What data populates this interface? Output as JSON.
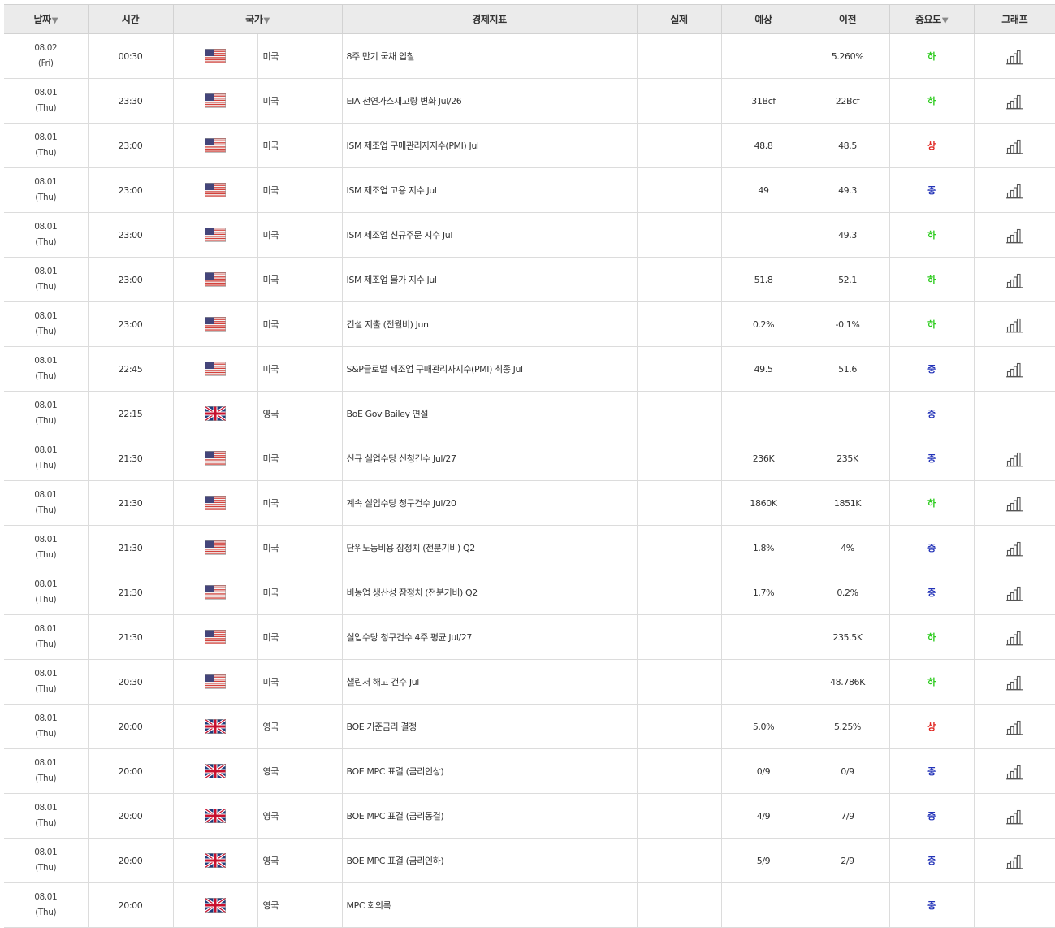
{
  "headers": {
    "date": "날짜",
    "time": "시간",
    "country": "국가",
    "indicator": "경제지표",
    "actual": "실제",
    "forecast": "예상",
    "previous": "이전",
    "importance": "중요도",
    "graph": "그래프",
    "sort_arrow": "▼"
  },
  "colors": {
    "importance_low": "#2ecc1f",
    "importance_mid": "#2333b8",
    "importance_high": "#e0241f",
    "header_bg": "#ebebeb"
  },
  "rows": [
    {
      "date": "08.02",
      "day": "(Fri)",
      "time": "00:30",
      "flag": "us",
      "country": "미국",
      "indicator": "8주 만기 국채 입찰",
      "actual": "",
      "forecast": "",
      "previous": "5.260%",
      "importance": "하",
      "level": "low",
      "graph": true
    },
    {
      "date": "08.01",
      "day": "(Thu)",
      "time": "23:30",
      "flag": "us",
      "country": "미국",
      "indicator": "EIA 천연가스재고량 변화 Jul/26",
      "actual": "",
      "forecast": "31Bcf",
      "previous": "22Bcf",
      "importance": "하",
      "level": "low",
      "graph": true
    },
    {
      "date": "08.01",
      "day": "(Thu)",
      "time": "23:00",
      "flag": "us",
      "country": "미국",
      "indicator": "ISM 제조업 구매관리자지수(PMI) Jul",
      "actual": "",
      "forecast": "48.8",
      "previous": "48.5",
      "importance": "상",
      "level": "high",
      "graph": true
    },
    {
      "date": "08.01",
      "day": "(Thu)",
      "time": "23:00",
      "flag": "us",
      "country": "미국",
      "indicator": "ISM 제조업 고용 지수 Jul",
      "actual": "",
      "forecast": "49",
      "previous": "49.3",
      "importance": "중",
      "level": "mid",
      "graph": true
    },
    {
      "date": "08.01",
      "day": "(Thu)",
      "time": "23:00",
      "flag": "us",
      "country": "미국",
      "indicator": "ISM 제조업 신규주문 지수 Jul",
      "actual": "",
      "forecast": "",
      "previous": "49.3",
      "importance": "하",
      "level": "low",
      "graph": true
    },
    {
      "date": "08.01",
      "day": "(Thu)",
      "time": "23:00",
      "flag": "us",
      "country": "미국",
      "indicator": "ISM 제조업 물가 지수 Jul",
      "actual": "",
      "forecast": "51.8",
      "previous": "52.1",
      "importance": "하",
      "level": "low",
      "graph": true
    },
    {
      "date": "08.01",
      "day": "(Thu)",
      "time": "23:00",
      "flag": "us",
      "country": "미국",
      "indicator": "건설 지출 (전월비) Jun",
      "actual": "",
      "forecast": "0.2%",
      "previous": "-0.1%",
      "importance": "하",
      "level": "low",
      "graph": true
    },
    {
      "date": "08.01",
      "day": "(Thu)",
      "time": "22:45",
      "flag": "us",
      "country": "미국",
      "indicator": "S&P글로벌 제조업 구매관리자지수(PMI) 최종 Jul",
      "actual": "",
      "forecast": "49.5",
      "previous": "51.6",
      "importance": "중",
      "level": "mid",
      "graph": true
    },
    {
      "date": "08.01",
      "day": "(Thu)",
      "time": "22:15",
      "flag": "uk",
      "country": "영국",
      "indicator": "BoE Gov Bailey 연설",
      "actual": "",
      "forecast": "",
      "previous": "",
      "importance": "중",
      "level": "mid",
      "graph": false
    },
    {
      "date": "08.01",
      "day": "(Thu)",
      "time": "21:30",
      "flag": "us",
      "country": "미국",
      "indicator": "신규 실업수당 신청건수 Jul/27",
      "actual": "",
      "forecast": "236K",
      "previous": "235K",
      "importance": "중",
      "level": "mid",
      "graph": true
    },
    {
      "date": "08.01",
      "day": "(Thu)",
      "time": "21:30",
      "flag": "us",
      "country": "미국",
      "indicator": "계속 실업수당 청구건수 Jul/20",
      "actual": "",
      "forecast": "1860K",
      "previous": "1851K",
      "importance": "하",
      "level": "low",
      "graph": true
    },
    {
      "date": "08.01",
      "day": "(Thu)",
      "time": "21:30",
      "flag": "us",
      "country": "미국",
      "indicator": "단위노동비용 잠정치 (전분기비) Q2",
      "actual": "",
      "forecast": "1.8%",
      "previous": "4%",
      "importance": "중",
      "level": "mid",
      "graph": true
    },
    {
      "date": "08.01",
      "day": "(Thu)",
      "time": "21:30",
      "flag": "us",
      "country": "미국",
      "indicator": "비농업 생산성 잠정치 (전분기비) Q2",
      "actual": "",
      "forecast": "1.7%",
      "previous": "0.2%",
      "importance": "중",
      "level": "mid",
      "graph": true
    },
    {
      "date": "08.01",
      "day": "(Thu)",
      "time": "21:30",
      "flag": "us",
      "country": "미국",
      "indicator": "실업수당 청구건수 4주 평균 Jul/27",
      "actual": "",
      "forecast": "",
      "previous": "235.5K",
      "importance": "하",
      "level": "low",
      "graph": true
    },
    {
      "date": "08.01",
      "day": "(Thu)",
      "time": "20:30",
      "flag": "us",
      "country": "미국",
      "indicator": "챌린저 해고 건수 Jul",
      "actual": "",
      "forecast": "",
      "previous": "48.786K",
      "importance": "하",
      "level": "low",
      "graph": true
    },
    {
      "date": "08.01",
      "day": "(Thu)",
      "time": "20:00",
      "flag": "uk",
      "country": "영국",
      "indicator": "BOE 기준금리 결정",
      "actual": "",
      "forecast": "5.0%",
      "previous": "5.25%",
      "importance": "상",
      "level": "high",
      "graph": true
    },
    {
      "date": "08.01",
      "day": "(Thu)",
      "time": "20:00",
      "flag": "uk",
      "country": "영국",
      "indicator": "BOE MPC 표결 (금리인상)",
      "actual": "",
      "forecast": "0/9",
      "previous": "0/9",
      "importance": "중",
      "level": "mid",
      "graph": true
    },
    {
      "date": "08.01",
      "day": "(Thu)",
      "time": "20:00",
      "flag": "uk",
      "country": "영국",
      "indicator": "BOE MPC 표결 (금리동결)",
      "actual": "",
      "forecast": "4/9",
      "previous": "7/9",
      "importance": "중",
      "level": "mid",
      "graph": true
    },
    {
      "date": "08.01",
      "day": "(Thu)",
      "time": "20:00",
      "flag": "uk",
      "country": "영국",
      "indicator": "BOE MPC 표결 (금리인하)",
      "actual": "",
      "forecast": "5/9",
      "previous": "2/9",
      "importance": "중",
      "level": "mid",
      "graph": true
    },
    {
      "date": "08.01",
      "day": "(Thu)",
      "time": "20:00",
      "flag": "uk",
      "country": "영국",
      "indicator": "MPC 회의록",
      "actual": "",
      "forecast": "",
      "previous": "",
      "importance": "중",
      "level": "mid",
      "graph": false
    }
  ]
}
